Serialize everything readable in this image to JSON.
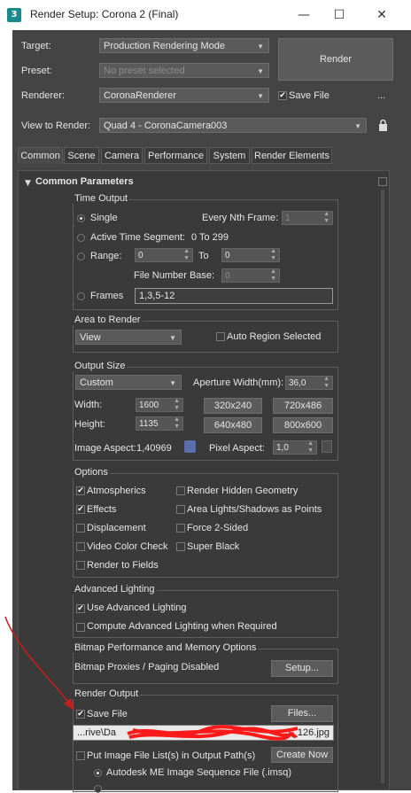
{
  "window": {
    "title": "Render Setup: Corona 2 (Final)",
    "minimize": "—",
    "maximize": "☐",
    "close": "✕"
  },
  "top": {
    "target_label": "Target:",
    "target_value": "Production Rendering Mode",
    "preset_label": "Preset:",
    "preset_value": "No preset selected",
    "renderer_label": "Renderer:",
    "renderer_value": "CoronaRenderer",
    "view_label": "View to Render:",
    "view_value": "Quad 4 - CoronaCamera003",
    "render_button": "Render",
    "save_file": "Save File",
    "more": "..."
  },
  "tabs": [
    "Common",
    "Scene",
    "Camera",
    "Performance",
    "System",
    "Render Elements"
  ],
  "rollout": {
    "title": "Common Parameters"
  },
  "time_output": {
    "title": "Time Output",
    "single": "Single",
    "every_nth": "Every Nth Frame:",
    "every_nth_value": "1",
    "active_segment": "Active Time Segment:",
    "active_segment_value": "0 To 299",
    "range": "Range:",
    "range_from": "0",
    "to": "To",
    "range_to": "0",
    "file_number_base": "File Number Base:",
    "file_number_base_value": "0",
    "frames": "Frames",
    "frames_value": "1,3,5-12"
  },
  "area": {
    "title": "Area to Render",
    "value": "View",
    "auto_region": "Auto Region Selected"
  },
  "output_size": {
    "title": "Output Size",
    "preset": "Custom",
    "aperture_label": "Aperture Width(mm):",
    "aperture_value": "36,0",
    "width_label": "Width:",
    "width_value": "1600",
    "height_label": "Height:",
    "height_value": "1135",
    "preset_buttons": [
      "320x240",
      "720x486",
      "640x480",
      "800x600"
    ],
    "image_aspect_label": "Image Aspect:",
    "image_aspect_value": "1,40969",
    "pixel_aspect_label": "Pixel Aspect:",
    "pixel_aspect_value": "1,0"
  },
  "options": {
    "title": "Options",
    "left": [
      "Atmospherics",
      "Effects",
      "Displacement",
      "Video Color Check",
      "Render to Fields"
    ],
    "left_checked": [
      true,
      true,
      false,
      false,
      false
    ],
    "right": [
      "Render Hidden Geometry",
      "Area Lights/Shadows as Points",
      "Force 2-Sided",
      "Super Black"
    ]
  },
  "advanced_lighting": {
    "title": "Advanced Lighting",
    "use": "Use Advanced Lighting",
    "compute": "Compute Advanced Lighting when Required"
  },
  "bitmap": {
    "title": "Bitmap Performance and Memory Options",
    "status": "Bitmap Proxies / Paging Disabled",
    "setup": "Setup..."
  },
  "render_output": {
    "title": "Render Output",
    "save_file": "Save File",
    "files_button": "Files...",
    "path_start": "...rive\\Da",
    "path_end": "1_126.jpg",
    "put_list": "Put Image File List(s) in Output Path(s)",
    "create_now": "Create Now",
    "autodesk": "Autodesk ME Image Sequence File (.imsq)"
  },
  "colors": {
    "bg": "#444444",
    "panel": "#3a3a3a",
    "scribble": "#ff1a1a",
    "arrow": "#c81e1e"
  }
}
